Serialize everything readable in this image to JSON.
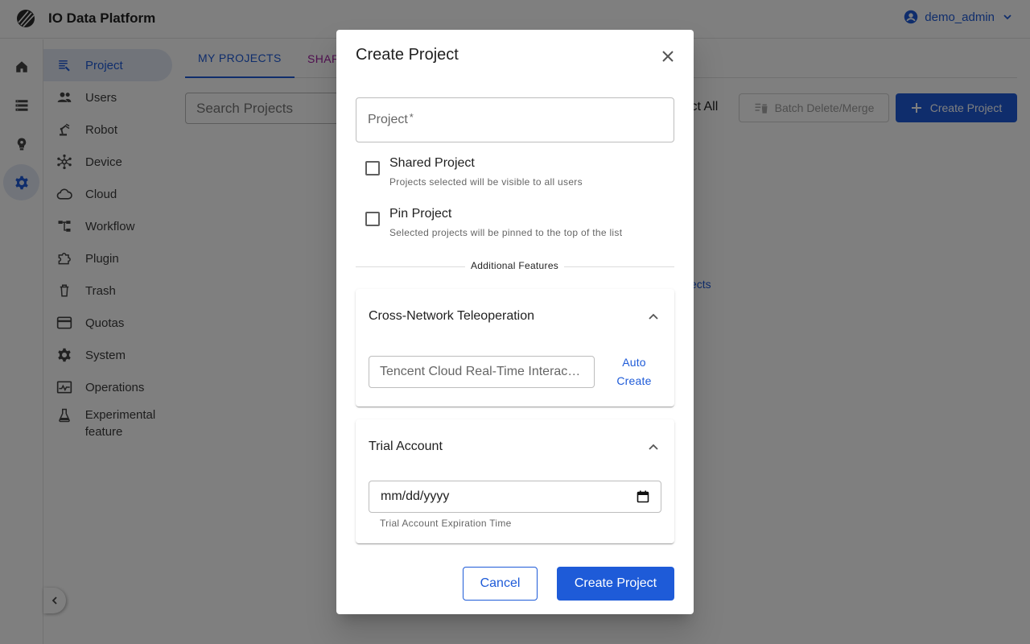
{
  "app": {
    "title": "IO Data Platform",
    "logo_icon": "striped-circle-logo"
  },
  "user": {
    "name": "demo_admin",
    "icon": "account-circle-icon"
  },
  "rail": [
    {
      "icon": "home-icon"
    },
    {
      "icon": "storage-icon"
    },
    {
      "icon": "lightbulb-icon"
    },
    {
      "icon": "gear-icon",
      "active": true
    }
  ],
  "sidebar": {
    "items": [
      {
        "label": "Project",
        "icon": "list-icon",
        "active": true
      },
      {
        "label": "Users",
        "icon": "people-icon"
      },
      {
        "label": "Robot",
        "icon": "robot-arm-icon"
      },
      {
        "label": "Device",
        "icon": "hub-icon"
      },
      {
        "label": "Cloud",
        "icon": "cloud-icon"
      },
      {
        "label": "Workflow",
        "icon": "workflow-icon"
      },
      {
        "label": "Plugin",
        "icon": "puzzle-icon"
      },
      {
        "label": "Trash",
        "icon": "trash-icon"
      },
      {
        "label": "Quotas",
        "icon": "credit-card-icon"
      },
      {
        "label": "System",
        "icon": "gear-icon"
      },
      {
        "label": "Operations",
        "icon": "monitor-icon"
      },
      {
        "label": "Experimental feature",
        "icon": "flask-icon"
      }
    ]
  },
  "main": {
    "tabs": [
      {
        "label": "MY PROJECTS",
        "active": true
      },
      {
        "label": "SHAR"
      }
    ],
    "search_placeholder": "Search Projects",
    "select_all": "lect All",
    "batch_button": "Batch Delete/Merge",
    "create_button": "Create Project",
    "link_fragment": "ects"
  },
  "dialog": {
    "title": "Create Project",
    "project_field": {
      "label": "Project",
      "required_mark": "*"
    },
    "shared": {
      "label": "Shared Project",
      "help": "Projects selected will be visible to all users",
      "checked": false
    },
    "pin": {
      "label": "Pin Project",
      "help": "Selected projects will be pinned to the top of the list",
      "checked": false
    },
    "divider_label": "Additional Features",
    "teleop": {
      "title": "Cross-Network Teleoperation",
      "input_placeholder": "Tencent Cloud Real-Time Interac…",
      "auto_create_line1": "Auto",
      "auto_create_line2": "Create"
    },
    "trial": {
      "title": "Trial Account",
      "date_placeholder": "mm/dd/yyyy",
      "helper": "Trial Account Expiration Time"
    },
    "cancel": "Cancel",
    "submit": "Create Project"
  },
  "colors": {
    "primary": "#1e5bd8",
    "overlay": "rgba(0,0,0,0.5)",
    "active_bg": "#e3e9f5",
    "tab_secondary": "#a020a0"
  }
}
